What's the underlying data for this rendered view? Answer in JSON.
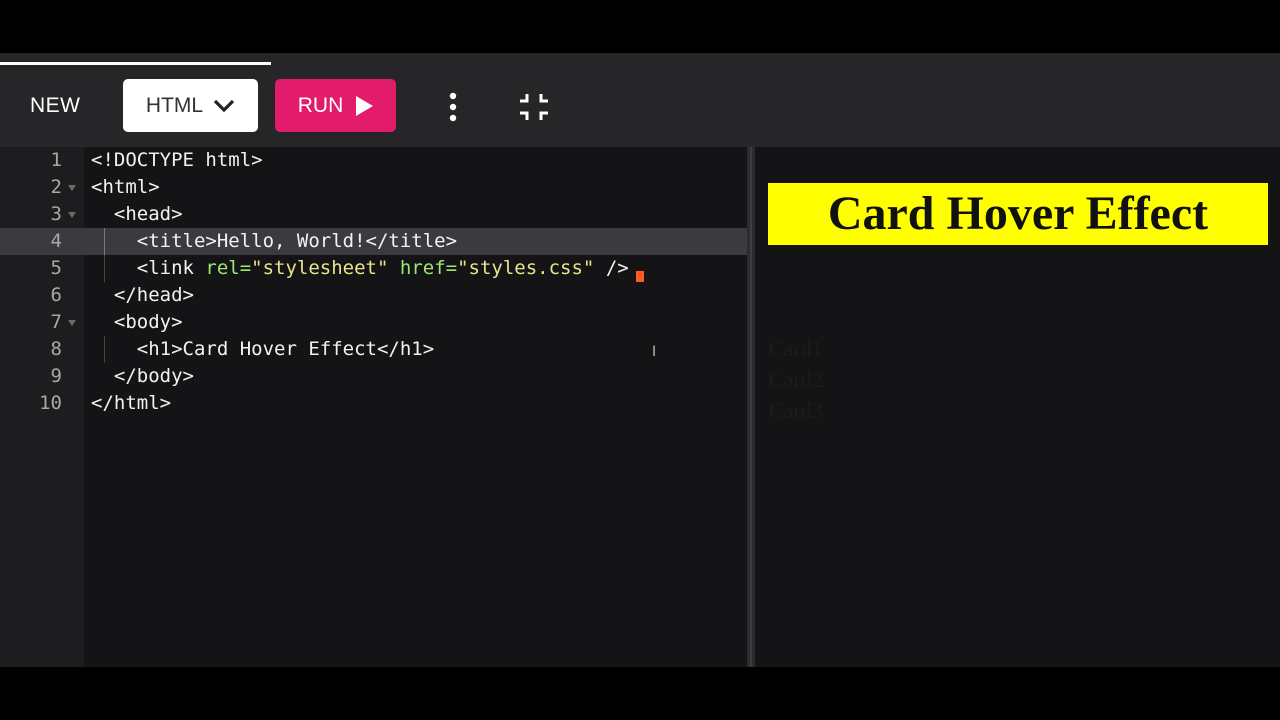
{
  "toolbar": {
    "new_label": "NEW",
    "language": "HTML",
    "run_label": "RUN"
  },
  "editor": {
    "active_line": 4,
    "line_numbers": [
      "1",
      "2",
      "3",
      "4",
      "5",
      "6",
      "7",
      "8",
      "9",
      "10"
    ],
    "lines": [
      [
        {
          "t": "<!DOCTYPE html>",
          "c": "tag"
        }
      ],
      [
        {
          "t": "<html>",
          "c": "tag"
        }
      ],
      [
        {
          "t": "  <head>",
          "c": "tag"
        }
      ],
      [
        {
          "t": "    <title>Hello, World!</title>",
          "c": "tag"
        }
      ],
      [
        {
          "t": "    <link ",
          "c": "tag"
        },
        {
          "t": "rel=",
          "c": "attr"
        },
        {
          "t": "\"stylesheet\"",
          "c": "str"
        },
        {
          "t": " ",
          "c": "tag"
        },
        {
          "t": "href=",
          "c": "attr"
        },
        {
          "t": "\"styles.css\"",
          "c": "str"
        },
        {
          "t": " />",
          "c": "tag"
        }
      ],
      [
        {
          "t": "  </head>",
          "c": "tag"
        }
      ],
      [
        {
          "t": "  <body>",
          "c": "tag"
        }
      ],
      [
        {
          "t": "    <h1>Card Hover Effect</h1>",
          "c": "tag"
        }
      ],
      [
        {
          "t": "  </body>",
          "c": "tag"
        }
      ],
      [
        {
          "t": "</html>",
          "c": "tag"
        }
      ]
    ]
  },
  "preview": {
    "heading": "Card Hover Effect",
    "cards": [
      "Card1",
      "Card2",
      "Card3"
    ]
  },
  "colors": {
    "run_button": "#e31b6b",
    "heading_background": "#ffff00",
    "attribute": "#9fe870",
    "string": "#e8e48a"
  },
  "icons": {
    "language_dropdown": "chevron-down-icon",
    "run": "play-icon",
    "more": "more-vertical-icon",
    "collapse": "collapse-icon"
  }
}
